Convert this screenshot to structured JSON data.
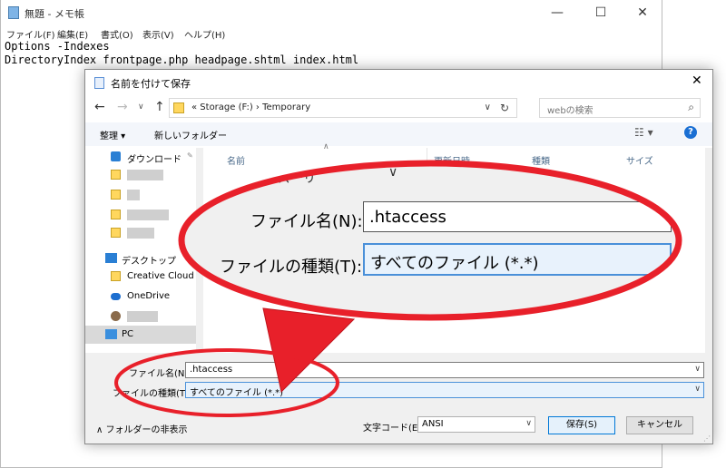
{
  "notepad": {
    "title": "無題 - メモ帳",
    "menus": [
      "ファイル(F)",
      "編集(E)",
      "書式(O)",
      "表示(V)",
      "ヘルプ(H)"
    ],
    "controls": {
      "minimize": "—",
      "maximize": "☐",
      "close": "✕"
    },
    "text": "Options -Indexes\nDirectoryIndex frontpage.php headpage.shtml index.html"
  },
  "dialog": {
    "title": "名前を付けて保存",
    "close": "✕",
    "nav": {
      "back": "←",
      "forward": "→",
      "down": "∨",
      "up": "↑"
    },
    "address": "« Storage (F:) › Temporary",
    "search_placeholder": "webの検索",
    "toolbar": {
      "organize": "整理 ▾",
      "new_folder": "新しいフォルダー",
      "view": "☷ ▾",
      "help": "?"
    },
    "sidebar": [
      {
        "label": "ダウンロード",
        "icon": "download-arrow-icon",
        "blurred": false
      },
      {
        "label": "",
        "icon": "folder-icon",
        "blurred": true
      },
      {
        "label": "",
        "icon": "folder-icon",
        "blurred": true
      },
      {
        "label": "",
        "icon": "folder-icon",
        "blurred": true
      },
      {
        "label": "",
        "icon": "folder-icon",
        "blurred": true
      },
      {
        "label": "デスクトップ",
        "icon": "desktop-icon",
        "blurred": false
      },
      {
        "label": "Creative Cloud F",
        "icon": "creative-cloud-icon",
        "blurred": false
      },
      {
        "label": "OneDrive",
        "icon": "cloud-icon",
        "blurred": false
      },
      {
        "label": "",
        "icon": "user-icon",
        "blurred": true
      },
      {
        "label": "PC",
        "icon": "pc-icon",
        "blurred": false
      }
    ],
    "columns": [
      "名前",
      "更新日時",
      "種類",
      "サイズ"
    ],
    "file_name_label": "ファイル名(N):",
    "file_name_value": ".htaccess",
    "file_type_label": "ファイルの種類(T):",
    "file_type_value": "すべてのファイル (*.*)",
    "hide_folders": "フォルダーの非表示",
    "encoding_label": "文字コード(E):",
    "encoding_value": "ANSI",
    "save_button": "保存(S)",
    "cancel_button": "キャンセル"
  },
  "zoom": {
    "file_name_label": "ファイル名(N):",
    "file_name_value": ".htaccess",
    "file_type_label": "ファイルの種類(T):",
    "file_type_value": "すべてのファイル (*.*)",
    "top_fragment": "ノズーリ",
    "top_chevron": "∨"
  },
  "colors": {
    "callout_red": "#e8202a",
    "accent_blue": "#0078d7"
  }
}
